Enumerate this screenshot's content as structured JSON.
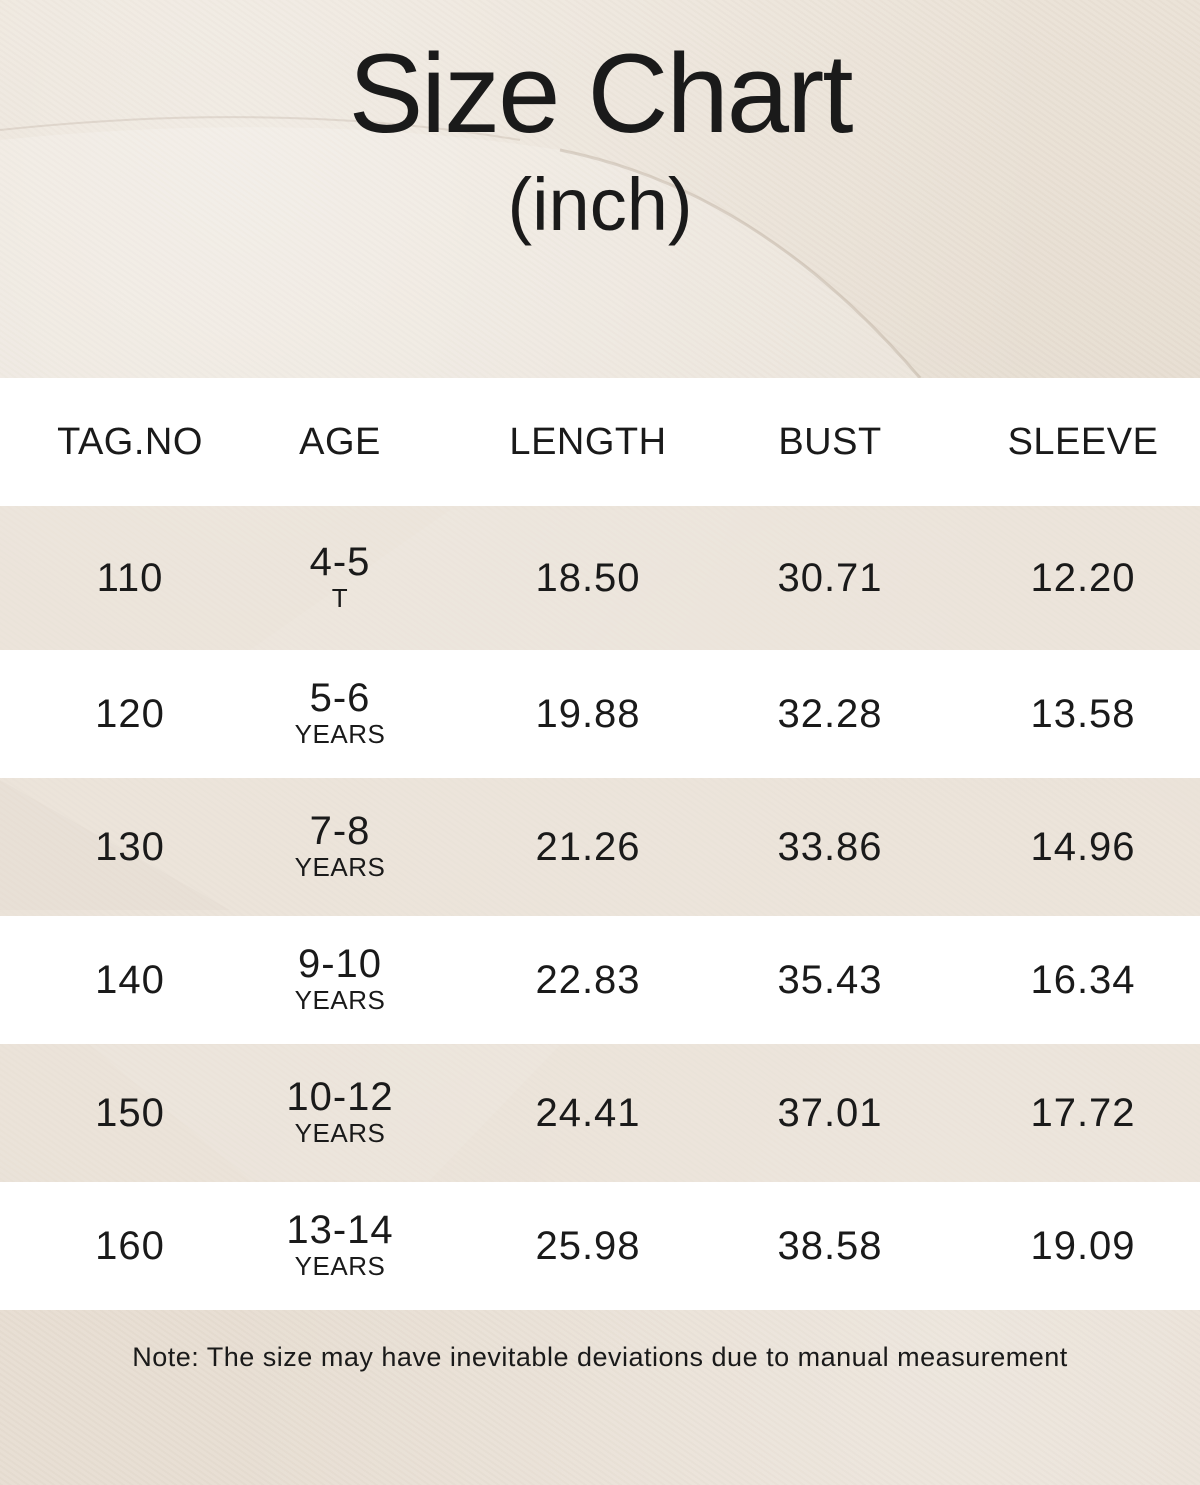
{
  "title": "Size Chart",
  "subtitle": "(inch)",
  "table": {
    "headers": [
      "TAG.NO",
      "AGE",
      "LENGTH",
      "BUST",
      "SLEEVE"
    ],
    "rows": [
      {
        "tag": "110",
        "age": "4-5",
        "age_unit": "T",
        "length": "18.50",
        "bust": "30.71",
        "sleeve": "12.20"
      },
      {
        "tag": "120",
        "age": "5-6",
        "age_unit": "YEARS",
        "length": "19.88",
        "bust": "32.28",
        "sleeve": "13.58"
      },
      {
        "tag": "130",
        "age": "7-8",
        "age_unit": "YEARS",
        "length": "21.26",
        "bust": "33.86",
        "sleeve": "14.96"
      },
      {
        "tag": "140",
        "age": "9-10",
        "age_unit": "YEARS",
        "length": "22.83",
        "bust": "35.43",
        "sleeve": "16.34"
      },
      {
        "tag": "150",
        "age": "10-12",
        "age_unit": "YEARS",
        "length": "24.41",
        "bust": "37.01",
        "sleeve": "17.72"
      },
      {
        "tag": "160",
        "age": "13-14",
        "age_unit": "YEARS",
        "length": "25.98",
        "bust": "38.58",
        "sleeve": "19.09"
      }
    ]
  },
  "note": "Note: The size may have inevitable deviations due to manual measurement",
  "colors": {
    "background": "#e9e1d7",
    "row_white": "#ffffff",
    "text": "#1a1a1a"
  }
}
